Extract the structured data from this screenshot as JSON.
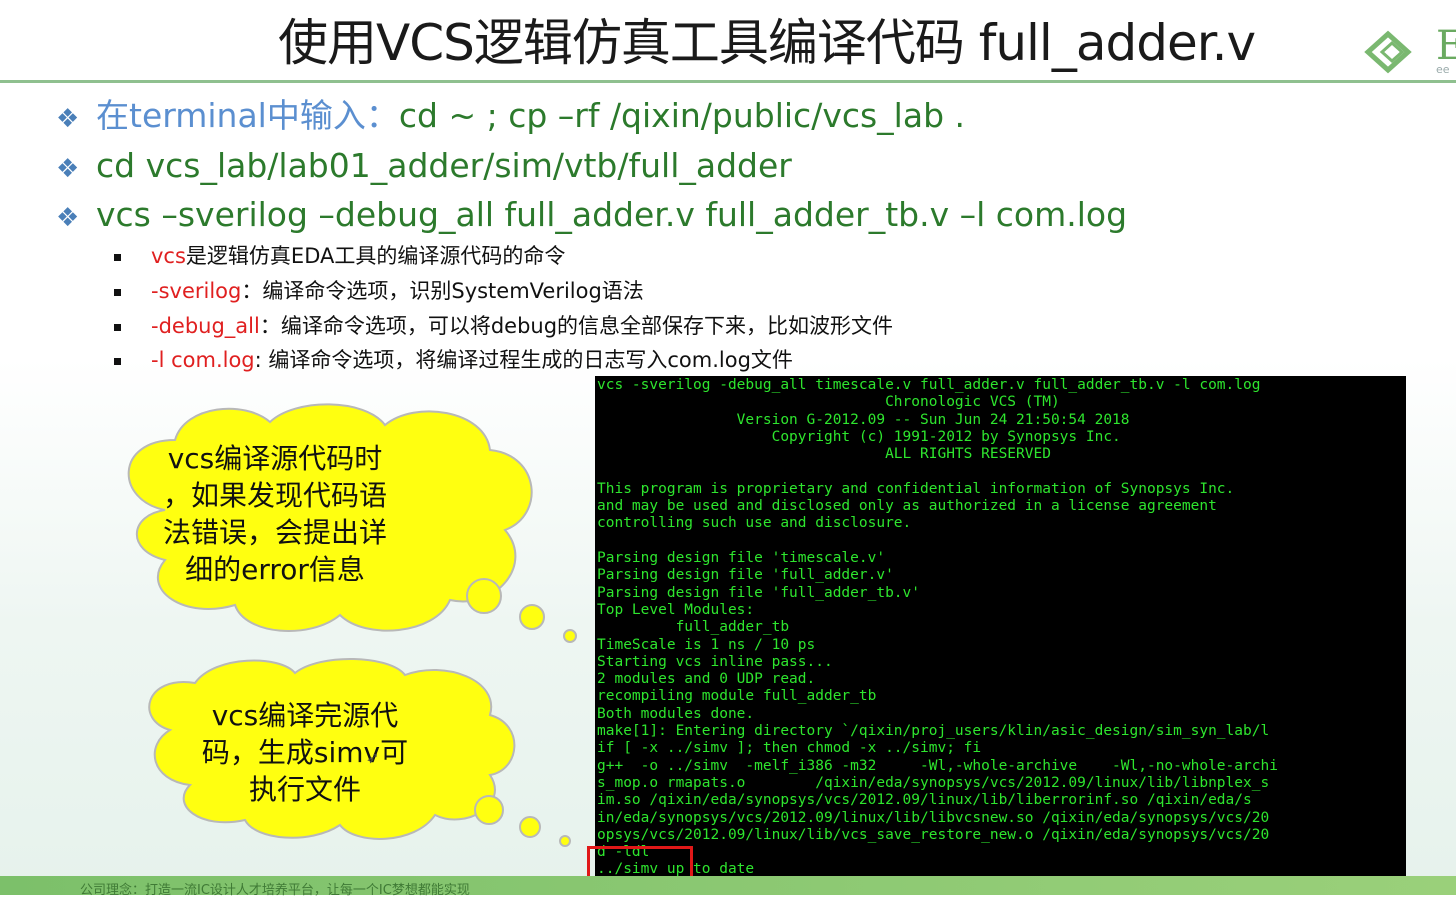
{
  "slide": {
    "title": "使用VCS逻辑仿真工具编译代码 full_adder.v",
    "logo": {
      "letter": "E",
      "sub": "ee",
      "color": "#6aaa60"
    },
    "bullets": [
      {
        "prefix": "在terminal中输入：",
        "text": "cd ~ ; cp  –rf  /qixin/public/vcs_lab  ."
      },
      {
        "prefix": "",
        "text": "cd  vcs_lab/lab01_adder/sim/vtb/full_adder"
      },
      {
        "prefix": "",
        "text": "vcs  –sverilog  –debug_all  full_adder.v  full_adder_tb.v  –l  com.log"
      }
    ],
    "sub_bullets": [
      {
        "key": "vcs",
        "desc": "是逻辑仿真EDA工具的编译源代码的命令"
      },
      {
        "key": "-sverilog",
        "desc": "：编译命令选项，识别SystemVerilog语法"
      },
      {
        "key": "-debug_all",
        "desc": "：编译命令选项，可以将debug的信息全部保存下来，比如波形文件"
      },
      {
        "key": "-l com.log",
        "desc": ": 编译命令选项，将编译过程生成的日志写入com.log文件"
      }
    ],
    "callouts": [
      {
        "line1": "vcs编译源代码时",
        "line2": "，如果发现代码语",
        "line3": "法错误，会提出详",
        "line4": "细的error信息"
      },
      {
        "line1": "vcs编译完源代",
        "line2": "码，生成simv可",
        "line3": "执行文件"
      }
    ],
    "bottom_text": "公司理念：打造一流IC设计人才培养平台，让每一个IC梦想都能实现",
    "colors": {
      "accent_green": "#2c7a2c",
      "highlight_red": "#e02020",
      "terminal_green": "#2ee52e",
      "cloud_yellow": "#ffff10"
    }
  },
  "terminal": {
    "lines": [
      "vcs -sverilog -debug_all timescale.v full_adder.v full_adder_tb.v -l com.log",
      "                                 Chronologic VCS (TM)",
      "                Version G-2012.09 -- Sun Jun 24 21:50:54 2018",
      "                    Copyright (c) 1991-2012 by Synopsys Inc.",
      "                                 ALL RIGHTS RESERVED",
      "",
      "This program is proprietary and confidential information of Synopsys Inc.",
      "and may be used and disclosed only as authorized in a license agreement",
      "controlling such use and disclosure.",
      "",
      "Parsing design file 'timescale.v'",
      "Parsing design file 'full_adder.v'",
      "Parsing design file 'full_adder_tb.v'",
      "Top Level Modules:",
      "         full_adder_tb",
      "TimeScale is 1 ns / 10 ps",
      "Starting vcs inline pass...",
      "2 modules and 0 UDP read.",
      "recompiling module full_adder_tb",
      "Both modules done.",
      "make[1]: Entering directory `/qixin/proj_users/klin/asic_design/sim_syn_lab/l",
      "if [ -x ../simv ]; then chmod -x ../simv; fi",
      "g++  -o ../simv  -melf_i386 -m32     -Wl,-whole-archive    -Wl,-no-whole-archi",
      "s_mop.o rmapats.o        /qixin/eda/synopsys/vcs/2012.09/linux/lib/libnplex_s",
      "im.so /qixin/eda/synopsys/vcs/2012.09/linux/lib/liberrorinf.so /qixin/eda/s",
      "in/eda/synopsys/vcs/2012.09/linux/lib/libvcsnew.so /qixin/eda/synopsys/vcs/20",
      "opsys/vcs/2012.09/linux/lib/vcs_save_restore_new.o /qixin/eda/synopsys/vcs/20",
      "d -ldl",
      "../simv up to date"
    ]
  }
}
